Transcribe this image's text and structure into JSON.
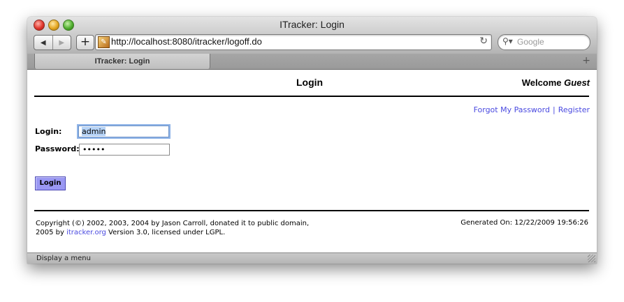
{
  "window": {
    "title": "ITracker: Login"
  },
  "browser": {
    "url": "http://localhost:8080/itracker/logoff.do",
    "search_placeholder": "Google",
    "add_label": "+",
    "back_glyph": "◀",
    "forward_glyph": "▶",
    "reload_glyph": "↻",
    "newtab_glyph": "+",
    "tab_label": "ITracker: Login"
  },
  "page": {
    "title": "Login",
    "welcome_prefix": "Welcome ",
    "welcome_user": "Guest",
    "links": {
      "forgot_password": "Forgot My Password",
      "separator": "|",
      "register": "Register"
    },
    "form": {
      "login_label": "Login:",
      "login_value": "admin",
      "password_label": "Password:",
      "password_value": "•••••",
      "submit_label": "Login"
    },
    "footer": {
      "copyright_line1": "Copyright (©) 2002, 2003, 2004 by Jason Carroll, donated it to public domain,",
      "copyright_line2_prefix": "2005 by ",
      "copyright_link": "itracker.org",
      "copyright_line2_suffix": " Version 3.0, licensed under LGPL.",
      "generated": "Generated On: 12/22/2009 19:56:26"
    }
  },
  "statusbar": {
    "text": "Display a menu"
  },
  "icons": {
    "close": "close-icon",
    "minimize": "minimize-icon",
    "zoom": "zoom-icon",
    "favicon": "itracker-favicon-icon",
    "search": "search-icon",
    "reload": "reload-icon"
  }
}
